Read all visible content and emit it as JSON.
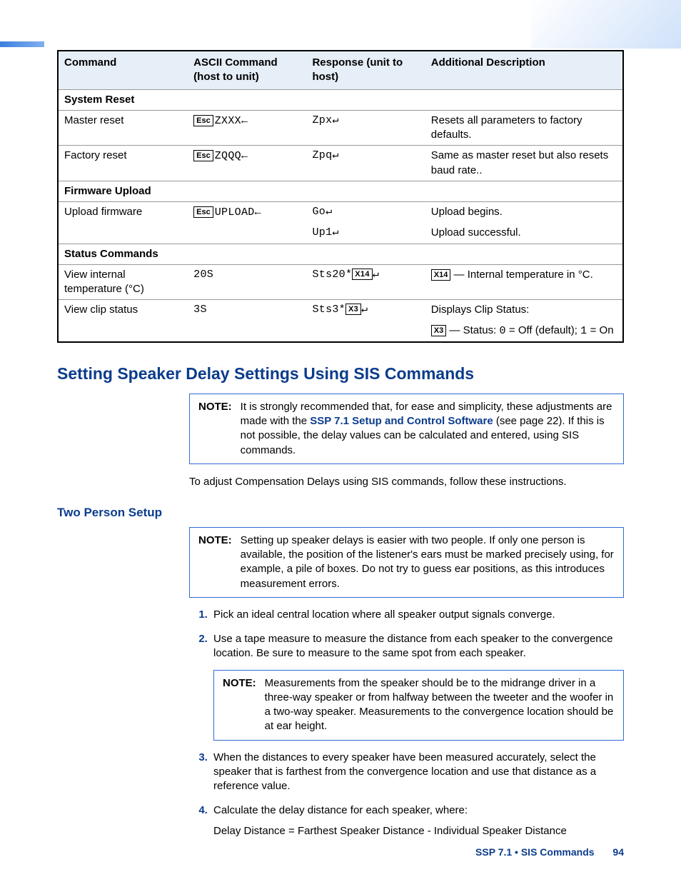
{
  "table": {
    "headers": [
      "Command",
      "ASCII Command (host to unit)",
      "Response (unit to host)",
      "Additional Description"
    ],
    "sections": {
      "system_reset": "System Reset",
      "firmware_upload": "Firmware Upload",
      "status_commands": "Status Commands"
    },
    "rows": {
      "master_reset": {
        "cmd": "Master reset",
        "ascii_pre": "Z",
        "ascii_main": "XXX",
        "ascii_tail": "←",
        "resp": "Zpx",
        "resp_tail": "↵",
        "desc": "Resets all parameters to factory defaults."
      },
      "factory_reset": {
        "cmd": "Factory reset",
        "ascii_pre": "Z",
        "ascii_main": "QQQ",
        "ascii_tail": "←",
        "resp": "Zpq",
        "resp_tail": "↵",
        "desc": "Same as master reset but also resets baud rate.."
      },
      "upload_fw": {
        "cmd": "Upload firmware",
        "ascii_main": "UPLOAD",
        "ascii_tail": "←",
        "resp1": "Go",
        "resp1_tail": "↵",
        "resp2": "Up1",
        "resp2_tail": "↵",
        "desc1": "Upload begins.",
        "desc2": "Upload successful."
      },
      "view_temp": {
        "cmd": "View internal temperature (°C)",
        "ascii": "20S",
        "resp_pre": "Sts20*",
        "xvar": "X14",
        "resp_tail": "↵",
        "desc_xvar": "X14",
        "desc": " — Internal temperature in °C."
      },
      "view_clip": {
        "cmd": "View clip status",
        "ascii": "3S",
        "resp_pre": "Sts3*",
        "xvar": "X3",
        "resp_tail": "↵",
        "desc1": "Displays Clip Status:",
        "desc2_xvar": "X3",
        "desc2_pre": " — Status: ",
        "desc2_zero": "0",
        "desc2_mid": " = Off (default); ",
        "desc2_one": "1",
        "desc2_post": " = On"
      }
    }
  },
  "esc_label": "Esc",
  "heading": "Setting Speaker Delay Settings Using SIS Commands",
  "note_label": "NOTE:",
  "note1_pre": "It is strongly recommended that, for ease and simplicity, these adjustments are made with the ",
  "note1_link": "SSP 7.1 Setup and Control Software",
  "note1_post": " (see page 22). If this is not possible, the delay values can be calculated and entered, using SIS commands.",
  "intro": "To adjust Compensation Delays using SIS commands, follow these instructions.",
  "subheading": "Two Person Setup",
  "note2": "Setting up speaker delays is easier with two people. If only one person is available, the position of the listener's ears must be marked precisely using, for example, a pile of boxes. Do not try to guess ear positions, as this introduces measurement errors.",
  "steps": {
    "s1": "Pick an ideal central location where all speaker output signals converge.",
    "s2": "Use a tape measure to measure the distance from each speaker to the convergence location. Be sure to measure to the same spot from each speaker.",
    "s2_note": "Measurements from the speaker should be to the midrange driver in a three-way speaker or from halfway between the tweeter and the woofer in a two-way speaker. Measurements to the convergence location should be at ear height.",
    "s3": "When the distances to every speaker have been measured accurately, select the speaker that is farthest from the convergence location and use that distance as a reference value.",
    "s4": "Calculate the delay distance for each speaker, where:",
    "s4_eqn": "Delay Distance = Farthest Speaker Distance - Individual Speaker Distance"
  },
  "footer": {
    "title": "SSP 7.1 • SIS Commands",
    "page": "94"
  }
}
